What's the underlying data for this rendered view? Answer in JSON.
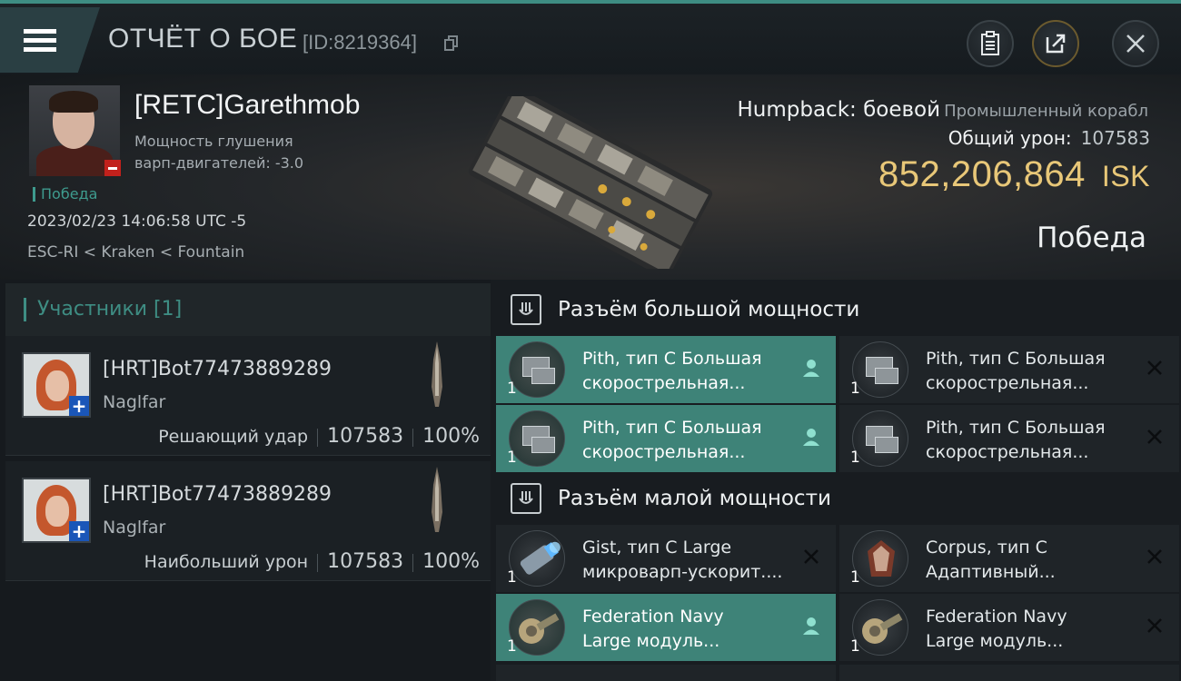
{
  "topbar": {
    "title": "ОТЧЁТ О БОЕ",
    "report_id": "[ID:8219364]"
  },
  "icons": [
    "menu-icon",
    "copy-icon",
    "clipboard-icon",
    "share-icon",
    "close-icon",
    "high-slot-icon",
    "low-slot-icon",
    "pilot-icon",
    "close-x-icon"
  ],
  "colors": {
    "accent": "#3e8d83",
    "isk": "#e8c778",
    "highlight": "#3e8378",
    "loss_badge": "#c2211c",
    "corp_badge": "#1a56b8"
  },
  "victim": {
    "name": "[RETC]Garethmob",
    "warp_label": "Мощность глушения варп-двигателей: -3.0",
    "result_tag": "Победа",
    "timestamp": "2023/02/23 14:06:58 UTC -5",
    "location": "ESC-RI < Kraken < Fountain"
  },
  "ship": {
    "name": "Humpback: боевой",
    "class": "Промышленный корабл",
    "total_damage_label": "Общий урон:",
    "total_damage": "107583",
    "isk_value": "852,206,864",
    "isk_unit": "ISK",
    "result": "Победа"
  },
  "participants": {
    "header": "Участники [1]",
    "items": [
      {
        "name": "[HRT]Bot77473889289",
        "ship": "Naglfar",
        "role": "Решающий удар",
        "damage": "107583",
        "percent": "100%"
      },
      {
        "name": "[HRT]Bot77473889289",
        "ship": "Naglfar",
        "role": "Наибольший урон",
        "damage": "107583",
        "percent": "100%"
      }
    ]
  },
  "fitting": {
    "high_slots": {
      "title": "Разъём большой мощности",
      "modules": [
        {
          "line1": "Pith, тип С Большая",
          "line2": "скорострельная...",
          "qty": "1",
          "highlighted": true,
          "mark": "pilot-icon"
        },
        {
          "line1": "Pith, тип С Большая",
          "line2": "скорострельная...",
          "qty": "1",
          "highlighted": false,
          "mark": "close-x-icon"
        },
        {
          "line1": "Pith, тип С Большая",
          "line2": "скорострельная...",
          "qty": "1",
          "highlighted": true,
          "mark": "pilot-icon"
        },
        {
          "line1": "Pith, тип С Большая",
          "line2": "скорострельная...",
          "qty": "1",
          "highlighted": false,
          "mark": "close-x-icon"
        }
      ]
    },
    "low_slots": {
      "title": "Разъём малой мощности",
      "modules": [
        {
          "line1": "Gist, тип С Large",
          "line2": "микроварп-ускорит....",
          "qty": "1",
          "highlighted": false,
          "mark": "close-x-icon"
        },
        {
          "line1": "Corpus, тип С",
          "line2": "Адаптивный...",
          "qty": "1",
          "highlighted": false,
          "mark": "close-x-icon"
        },
        {
          "line1": "Federation Navy",
          "line2": "Large модуль...",
          "qty": "1",
          "highlighted": true,
          "mark": "pilot-icon"
        },
        {
          "line1": "Federation Navy",
          "line2": "Large модуль...",
          "qty": "1",
          "highlighted": false,
          "mark": "close-x-icon"
        }
      ]
    }
  }
}
